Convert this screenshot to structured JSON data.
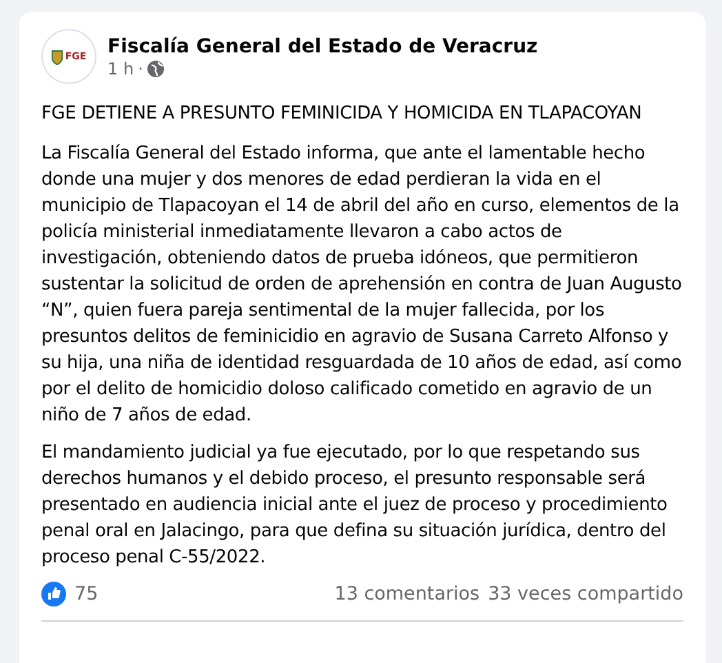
{
  "post": {
    "author": "Fiscalía General del Estado de Veracruz",
    "time": "1 h",
    "separator": "·",
    "avatar_text": "FGE",
    "headline": "FGE DETIENE A PRESUNTO FEMINICIDA Y HOMICIDA EN TLAPACOYAN",
    "paragraphs": [
      "La Fiscalía General del Estado informa, que ante el lamentable hecho donde una mujer y dos menores de edad perdieran la vida en el municipio de Tlapacoyan el 14 de abril del año en curso, elementos de la  policía ministerial inmediatamente llevaron  a cabo actos de investigación, obteniendo datos de prueba idóneos, que permitieron sustentar la solicitud de orden de aprehensión en contra de Juan Augusto “N”, quien fuera pareja sentimental de la mujer fallecida, por los presuntos delitos de feminicidio en agravio de Susana Carreto Alfonso y su hija, una niña de identidad resguardada de 10 años de edad, así como por el delito de homicidio doloso calificado cometido en agravio de un niño de 7 años de edad.",
      "El mandamiento judicial ya fue ejecutado, por lo que respetando sus derechos humanos y el debido proceso, el presunto responsable será presentado en audiencia inicial ante el  juez de  proceso y procedimiento penal oral en Jalacingo,  para que defina su situación jurídica, dentro del proceso penal C-55/2022."
    ],
    "reactions": "75",
    "comments": "13 comentarios",
    "shares": "33 veces compartido"
  }
}
